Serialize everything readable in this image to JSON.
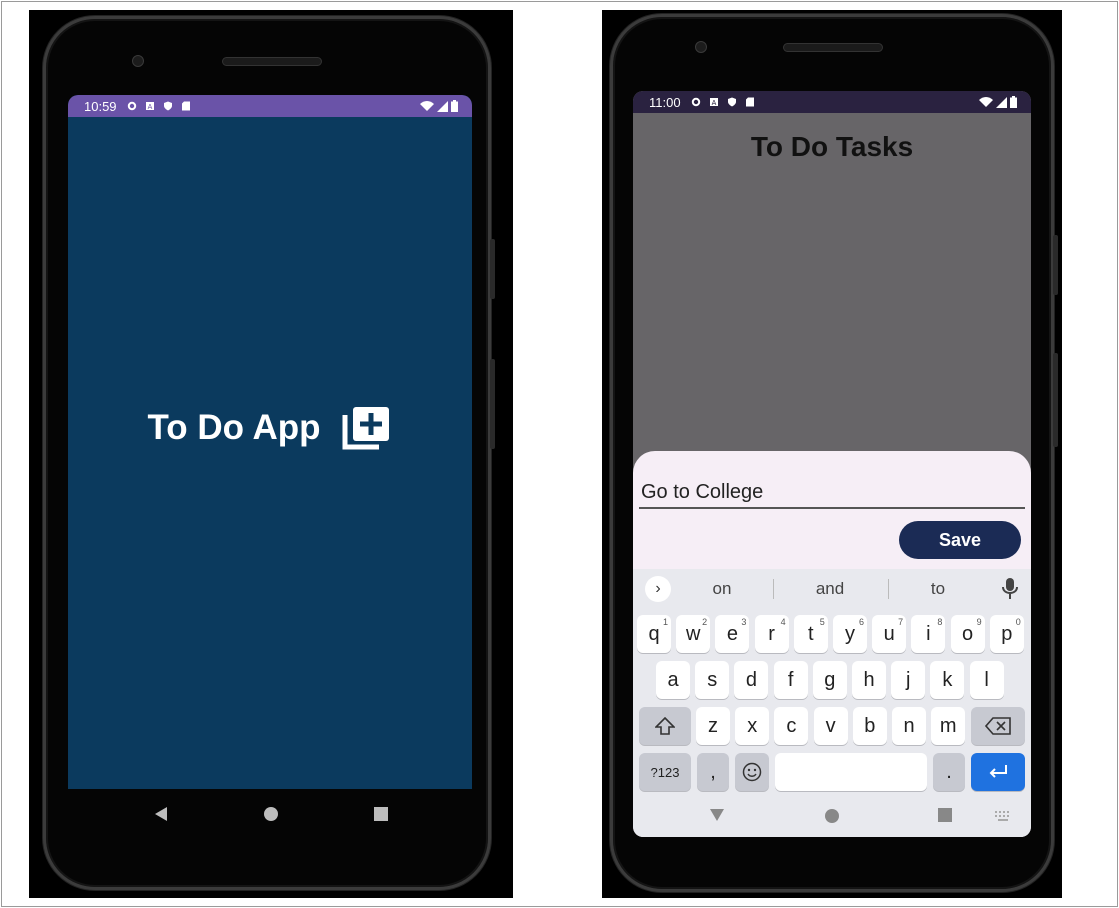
{
  "left_phone": {
    "status": {
      "time": "10:59"
    },
    "splash": {
      "title": "To Do App",
      "icon": "add-to-library-icon"
    },
    "nav": {
      "back_icon": "back-triangle-icon",
      "home_icon": "home-circle-icon",
      "recents_icon": "recents-square-icon"
    }
  },
  "right_phone": {
    "status": {
      "time": "11:00"
    },
    "title": "To Do Tasks",
    "task_input": {
      "value": "Go to College"
    },
    "save_label": "Save",
    "keyboard": {
      "suggestions": [
        "on",
        "and",
        "to"
      ],
      "row1": [
        {
          "k": "q",
          "n": "1"
        },
        {
          "k": "w",
          "n": "2"
        },
        {
          "k": "e",
          "n": "3"
        },
        {
          "k": "r",
          "n": "4"
        },
        {
          "k": "t",
          "n": "5"
        },
        {
          "k": "y",
          "n": "6"
        },
        {
          "k": "u",
          "n": "7"
        },
        {
          "k": "i",
          "n": "8"
        },
        {
          "k": "o",
          "n": "9"
        },
        {
          "k": "p",
          "n": "0"
        }
      ],
      "row2": [
        "a",
        "s",
        "d",
        "f",
        "g",
        "h",
        "j",
        "k",
        "l"
      ],
      "row3": [
        "z",
        "x",
        "c",
        "v",
        "b",
        "n",
        "m"
      ],
      "symbols_key": "?123",
      "comma_key": ",",
      "period_key": "."
    }
  },
  "colors": {
    "splash_bg": "#0b3a5e",
    "save_bg": "#1b2b55",
    "enter_key": "#1f72e0"
  }
}
